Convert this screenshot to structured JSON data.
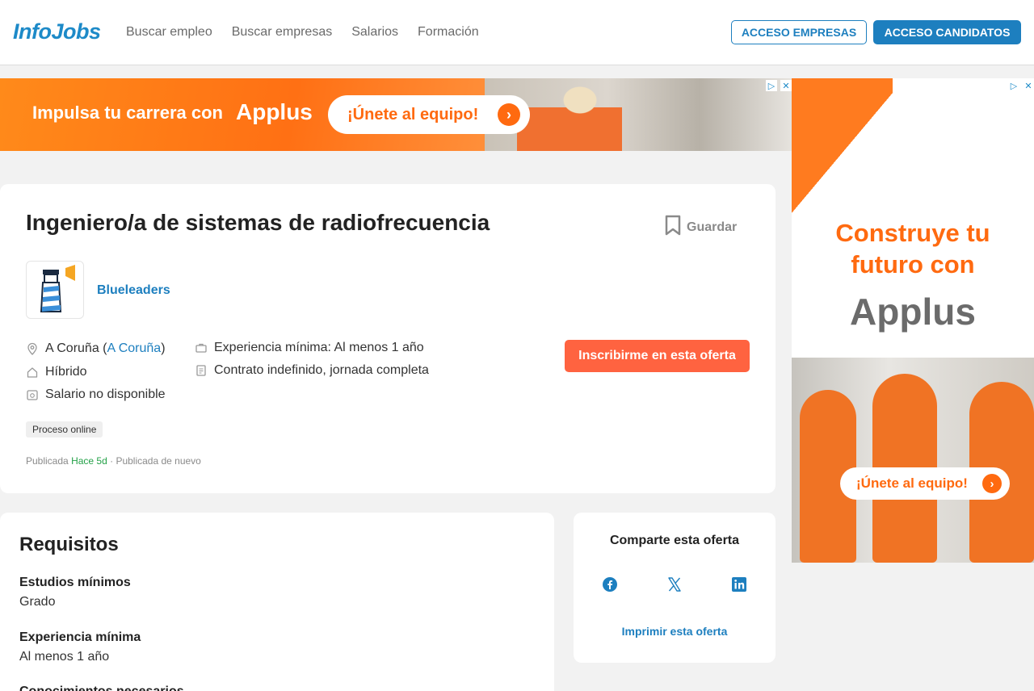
{
  "header": {
    "logo": "InfoJobs",
    "nav": [
      "Buscar empleo",
      "Buscar empresas",
      "Salarios",
      "Formación"
    ],
    "btn_empresas": "ACCESO EMPRESAS",
    "btn_candidatos": "ACCESO CANDIDATOS"
  },
  "ad_top": {
    "tagline": "Impulsa tu carrera con",
    "brand": "Applus",
    "cta": "¡Únete al equipo!"
  },
  "ad_side": {
    "headline_1": "Construye tu",
    "headline_2": "futuro con",
    "brand": "Applus",
    "cta": "¡Únete al equipo!"
  },
  "job": {
    "title": "Ingeniero/a de sistemas de radiofrecuencia",
    "save_label": "Guardar",
    "company": "Blueleaders",
    "location_city": "A Coruña (",
    "location_link": "A Coruña",
    "location_close": ")",
    "work_mode": "Híbrido",
    "salary": "Salario no disponible",
    "experience": "Experiencia mínima: Al menos 1 año",
    "contract": "Contrato indefinido, jornada completa",
    "apply_label": "Inscribirme en esta oferta",
    "tag": "Proceso online",
    "published_prefix": "Publicada",
    "published_ago": "Hace 5d",
    "published_suffix": "· Publicada de nuevo"
  },
  "requirements": {
    "title": "Requisitos",
    "items": [
      {
        "label": "Estudios mínimos",
        "value": "Grado"
      },
      {
        "label": "Experiencia mínima",
        "value": "Al menos 1 año"
      },
      {
        "label": "Conocimientos necesarios",
        "value": ""
      }
    ]
  },
  "share": {
    "title": "Comparte esta oferta",
    "print_label": "Imprimir esta oferta"
  },
  "colors": {
    "brand_blue": "#1d7fbf",
    "apply_orange": "#ff6340",
    "ad_orange": "#ff7b1f"
  }
}
